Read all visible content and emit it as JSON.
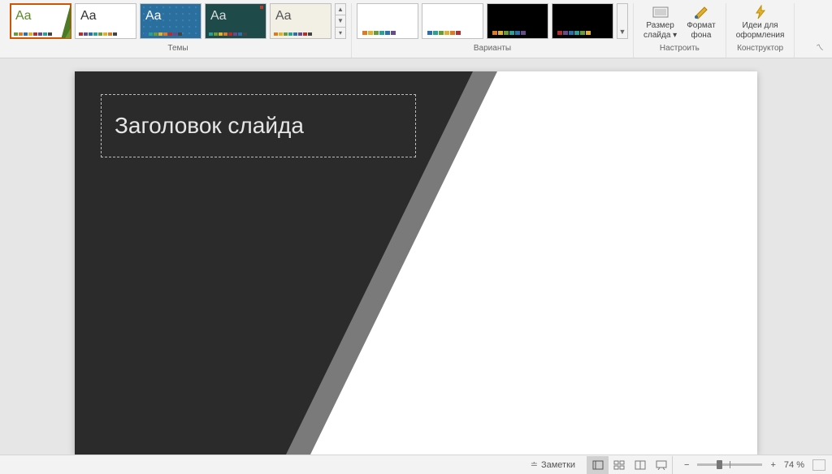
{
  "ribbon": {
    "themes_label": "Темы",
    "variants_label": "Варианты",
    "customize_label": "Настроить",
    "designer_label": "Конструктор",
    "size_btn": "Размер\nслайда ▾",
    "format_btn": "Формат\nфона",
    "ideas_btn": "Идеи для\nоформления",
    "themes": [
      {
        "aa": "Aa",
        "txt": "#5a8a2a",
        "bg": "#fff",
        "selected": true
      },
      {
        "aa": "Aa",
        "txt": "#333",
        "bg": "#fff"
      },
      {
        "aa": "Aa",
        "txt": "#fff",
        "bg": "#2b6f9e",
        "pattern": true
      },
      {
        "aa": "Aa",
        "txt": "#ddd",
        "bg": "#1e4a4a"
      },
      {
        "aa": "Aa",
        "txt": "#555",
        "bg": "#f2efe4"
      }
    ],
    "variants": [
      {
        "bg": "#fff"
      },
      {
        "bg": "#fff"
      },
      {
        "bg": "#000"
      },
      {
        "bg": "#000"
      }
    ]
  },
  "slide": {
    "title_placeholder": "Заголовок слайда"
  },
  "status": {
    "notes": "Заметки",
    "zoom_pct": "74 %"
  }
}
